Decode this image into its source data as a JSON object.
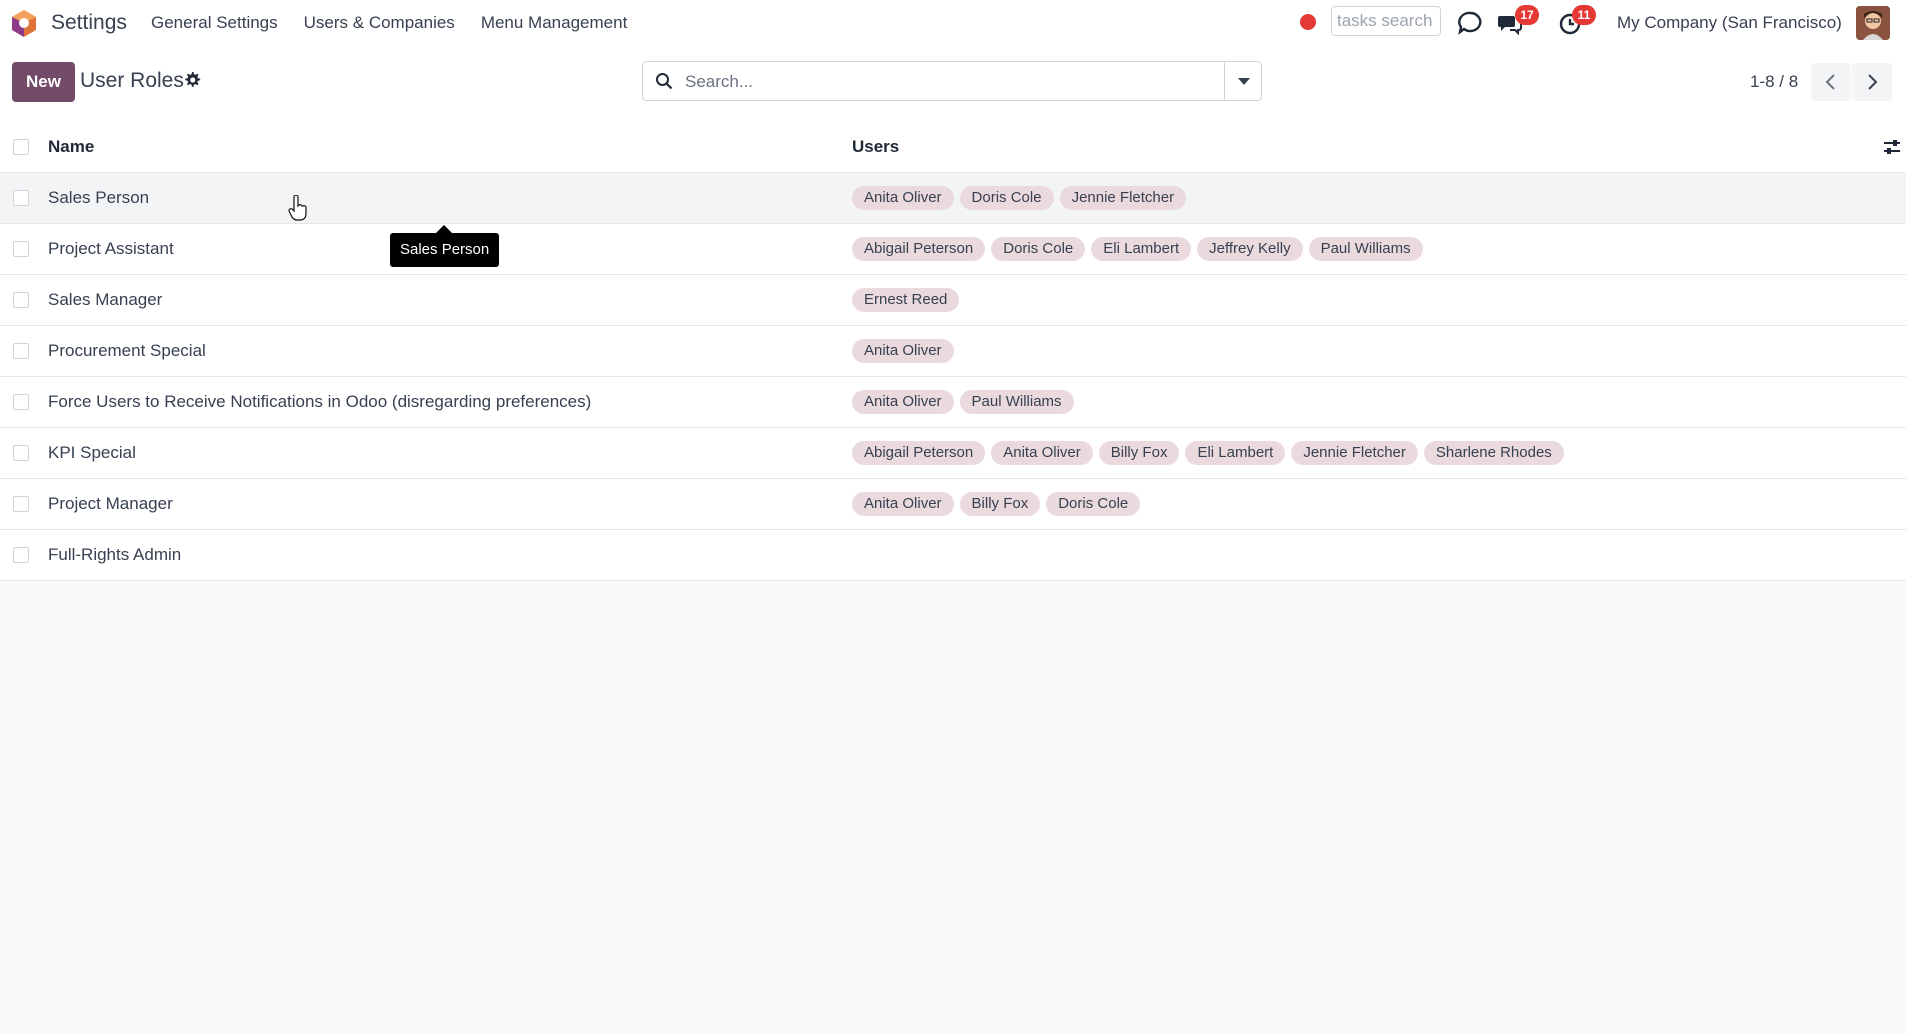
{
  "navbar": {
    "app_name": "Settings",
    "menu": [
      "General Settings",
      "Users & Companies",
      "Menu Management"
    ],
    "tasks_search_placeholder": "tasks search",
    "chat_badge": "17",
    "activity_badge": "11",
    "company": "My Company (San Francisco)"
  },
  "control_panel": {
    "new_label": "New",
    "title": "User Roles",
    "search_placeholder": "Search...",
    "pager": "1-8 / 8"
  },
  "list": {
    "headers": {
      "name": "Name",
      "users": "Users"
    },
    "rows": [
      {
        "name": "Sales Person",
        "users": [
          "Anita Oliver",
          "Doris Cole",
          "Jennie Fletcher"
        ]
      },
      {
        "name": "Project Assistant",
        "users": [
          "Abigail Peterson",
          "Doris Cole",
          "Eli Lambert",
          "Jeffrey Kelly",
          "Paul Williams"
        ]
      },
      {
        "name": "Sales Manager",
        "users": [
          "Ernest Reed"
        ]
      },
      {
        "name": "Procurement Special",
        "users": [
          "Anita Oliver"
        ]
      },
      {
        "name": "Force Users to Receive Notifications in Odoo (disregarding preferences)",
        "users": [
          "Anita Oliver",
          "Paul Williams"
        ]
      },
      {
        "name": "KPI Special",
        "users": [
          "Abigail Peterson",
          "Anita Oliver",
          "Billy Fox",
          "Eli Lambert",
          "Jennie Fletcher",
          "Sharlene Rhodes"
        ]
      },
      {
        "name": "Project Manager",
        "users": [
          "Anita Oliver",
          "Billy Fox",
          "Doris Cole"
        ]
      },
      {
        "name": "Full-Rights Admin",
        "users": []
      }
    ]
  },
  "tooltip": "Sales Person",
  "colors": {
    "brand": "#714b67",
    "tag_bg": "#ebdadd",
    "badge": "#e53935"
  }
}
